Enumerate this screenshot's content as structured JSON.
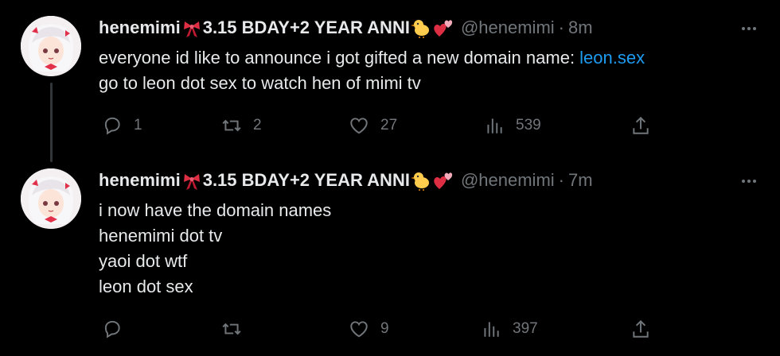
{
  "tweets": [
    {
      "name": "henemimi",
      "name_suffix": "3.15 BDAY+2 YEAR ANNI",
      "handle": "@henemimi",
      "separator": "·",
      "time": "8m",
      "text_prefix": "everyone id like to announce i got gifted a new domain name: ",
      "link": "leon.sex",
      "text_line2": "go to leon dot sex to watch hen of mimi tv",
      "reply_count": "1",
      "retweet_count": "2",
      "like_count": "27",
      "views_count": "539"
    },
    {
      "name": "henemimi",
      "name_suffix": "3.15 BDAY+2 YEAR ANNI",
      "handle": "@henemimi",
      "separator": "·",
      "time": "7m",
      "lines": [
        "i now have the domain names",
        "henemimi dot tv",
        "yaoi dot wtf",
        "leon dot sex"
      ],
      "reply_count": "",
      "retweet_count": "",
      "like_count": "9",
      "views_count": "397"
    }
  ],
  "icons": {
    "reply": "reply-icon",
    "retweet": "retweet-icon",
    "like": "heart-icon",
    "views": "views-icon",
    "share": "share-icon",
    "more": "more-icon"
  },
  "colors": {
    "background": "#000000",
    "text": "#e7e9ea",
    "secondary": "#71767b",
    "link": "#1d9bf0"
  }
}
